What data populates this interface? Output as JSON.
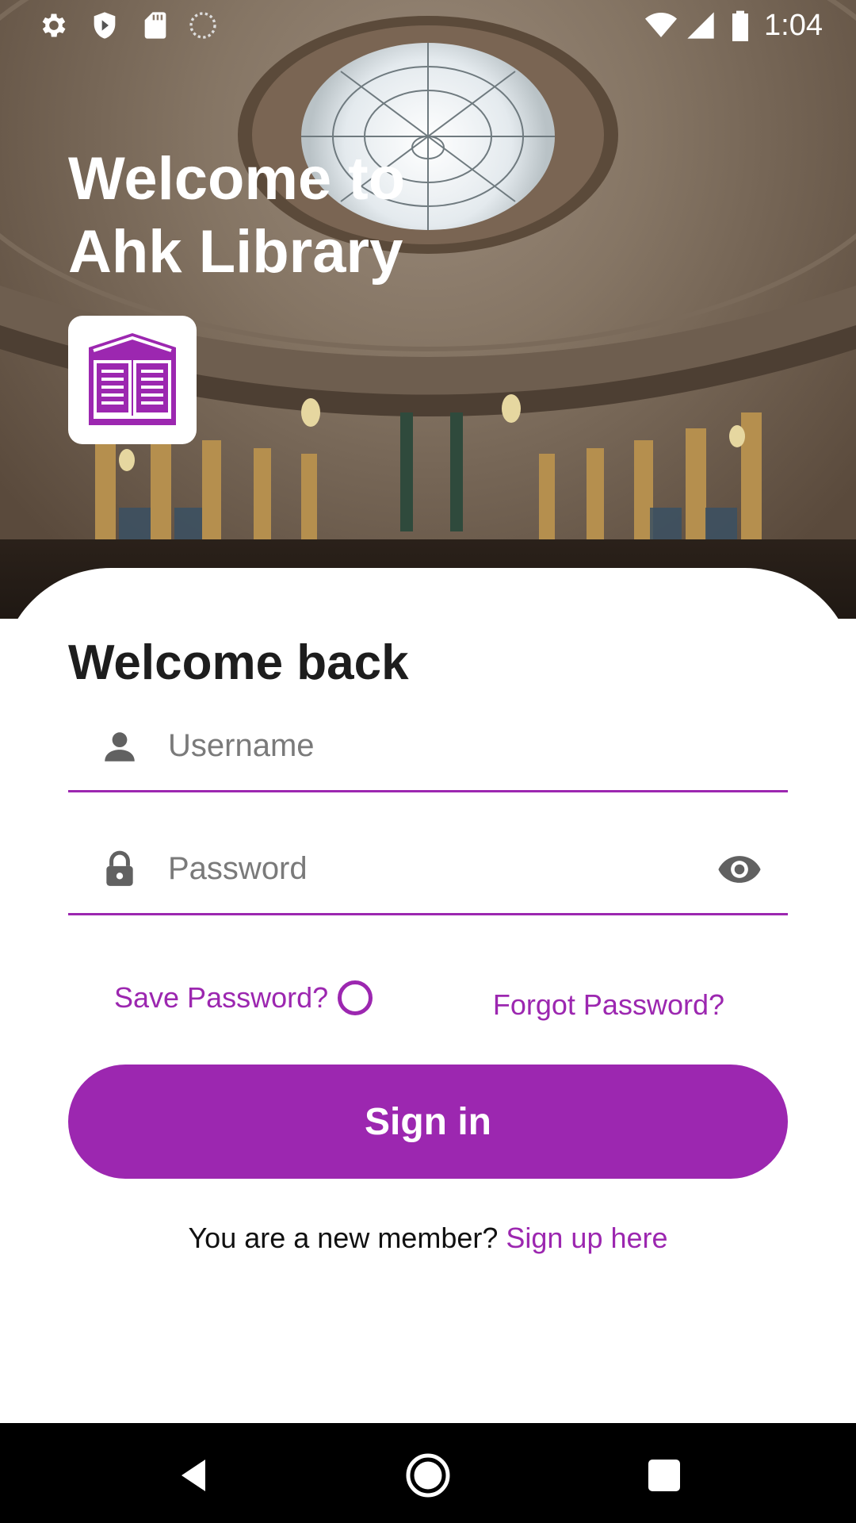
{
  "status_bar": {
    "time": "1:04",
    "left_icons": [
      "settings-icon",
      "shield-icon",
      "sd-card-icon",
      "sync-icon"
    ],
    "right_icons": [
      "wifi-icon",
      "signal-icon",
      "battery-icon"
    ]
  },
  "hero": {
    "title": "Welcome to\nAhk Library",
    "logo_icon": "open-book-icon"
  },
  "login": {
    "title": "Welcome back",
    "username_placeholder": "Username",
    "password_placeholder": "Password",
    "save_password_label": "Save Password?",
    "forgot_password_label": "Forgot Password?",
    "sign_in_label": "Sign in",
    "new_member_text": "You are a new member? ",
    "sign_up_link": "Sign up here"
  },
  "nav_bar": {
    "buttons": [
      "back-icon",
      "home-icon",
      "recents-icon"
    ]
  },
  "colors": {
    "accent": "#9c27b0",
    "text_dark": "#1d1d1d",
    "placeholder": "#7a7a7a"
  }
}
